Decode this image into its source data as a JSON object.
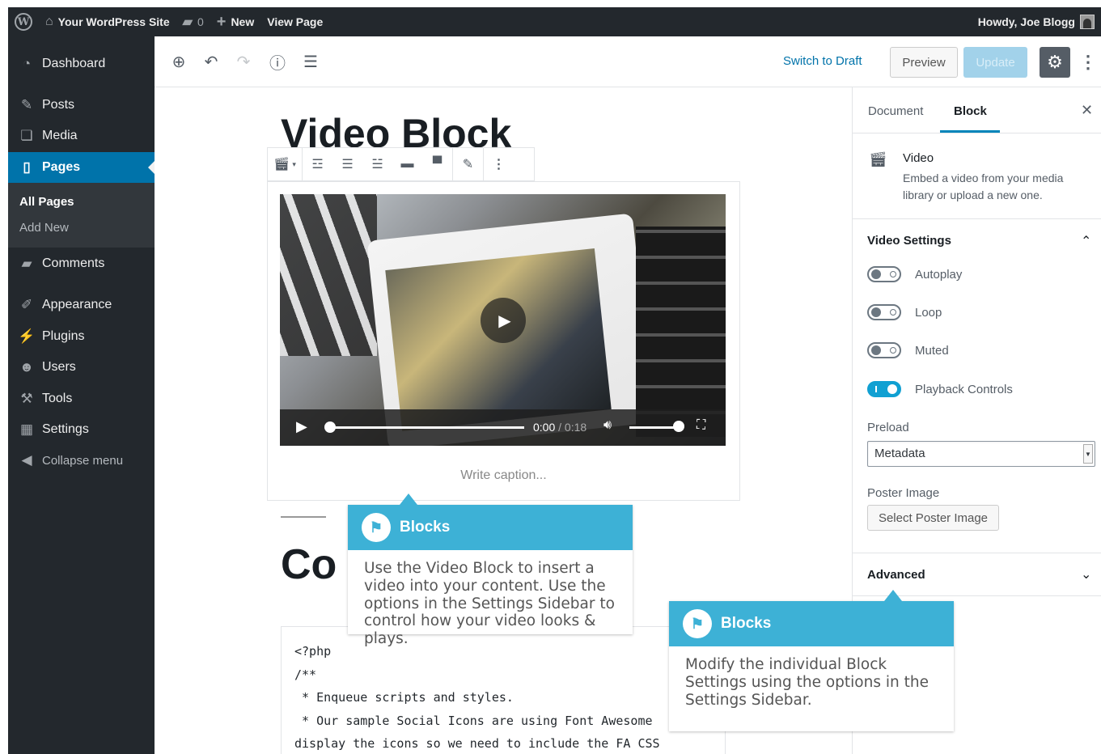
{
  "adminbar": {
    "site_name": "Your WordPress Site",
    "comments_count": "0",
    "new_label": "New",
    "view_page": "View Page",
    "howdy": "Howdy, Joe Blogg"
  },
  "menu": {
    "items": [
      {
        "label": "Dashboard",
        "icon": "dashboard-icon"
      },
      {
        "label": "Posts",
        "icon": "pin-icon"
      },
      {
        "label": "Media",
        "icon": "media-icon"
      },
      {
        "label": "Pages",
        "icon": "pages-icon"
      },
      {
        "label": "Comments",
        "icon": "comment-icon"
      },
      {
        "label": "Appearance",
        "icon": "brush-icon"
      },
      {
        "label": "Plugins",
        "icon": "plugin-icon"
      },
      {
        "label": "Users",
        "icon": "user-icon"
      },
      {
        "label": "Tools",
        "icon": "wrench-icon"
      },
      {
        "label": "Settings",
        "icon": "settings-icon"
      },
      {
        "label": "Collapse menu",
        "icon": "collapse-icon"
      }
    ],
    "submenu": [
      "All Pages",
      "Add New"
    ]
  },
  "toolbar": {
    "switch_to_draft": "Switch to Draft",
    "preview": "Preview",
    "update": "Update"
  },
  "editor": {
    "title": "Video Block",
    "caption_placeholder": "Write caption...",
    "video_time": "0:00",
    "video_duration": "/ 0:18",
    "heading2": "Co",
    "code_lines": [
      "<?php",
      "/**",
      " * Enqueue scripts and styles.",
      " * Our sample Social Icons are using Font Awesome",
      "display the icons so we need to include the FA CSS"
    ]
  },
  "sidebar": {
    "tabs": [
      "Document",
      "Block"
    ],
    "block_name": "Video",
    "block_desc": "Embed a video from your media library or upload a new one.",
    "video_settings_title": "Video Settings",
    "toggles": [
      {
        "label": "Autoplay",
        "on": false
      },
      {
        "label": "Loop",
        "on": false
      },
      {
        "label": "Muted",
        "on": false
      },
      {
        "label": "Playback Controls",
        "on": true
      }
    ],
    "preload_label": "Preload",
    "preload_value": "Metadata",
    "poster_label": "Poster Image",
    "poster_button": "Select Poster Image",
    "advanced_title": "Advanced"
  },
  "callouts": [
    {
      "title": "Blocks",
      "body": "Use the Video Block to insert a video into your content. Use the options in the Settings Sidebar to control how your video looks & plays."
    },
    {
      "title": "Blocks",
      "body": "Modify the individual Block Settings using the options in the Settings Sidebar."
    }
  ],
  "colors": {
    "accent": "#0073aa",
    "callout": "#3db1d6",
    "admin_dark": "#23282d"
  }
}
